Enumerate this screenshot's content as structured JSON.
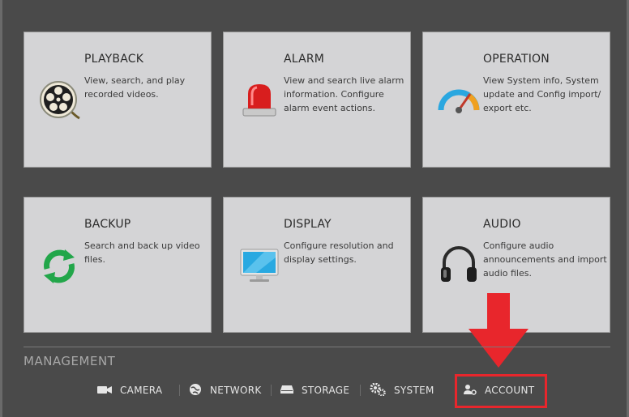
{
  "tiles": [
    {
      "id": "playback",
      "title": "PLAYBACK",
      "desc": "View, search, and play recorded videos.",
      "icon": "film-reel-icon"
    },
    {
      "id": "alarm",
      "title": "ALARM",
      "desc": "View and search live alarm information. Configure alarm event actions.",
      "icon": "siren-icon"
    },
    {
      "id": "operation",
      "title": "OPERATION",
      "desc": "View System info, System update and Config import/ export etc.",
      "icon": "gauge-icon"
    },
    {
      "id": "backup",
      "title": "BACKUP",
      "desc": "Search and back up video files.",
      "icon": "sync-arrows-icon"
    },
    {
      "id": "display",
      "title": "DISPLAY",
      "desc": "Configure resolution and display settings.",
      "icon": "monitor-icon"
    },
    {
      "id": "audio",
      "title": "AUDIO",
      "desc": "Configure audio announcements and import audio files.",
      "icon": "headphones-icon"
    }
  ],
  "management": {
    "title": "MANAGEMENT",
    "items": [
      {
        "label": "CAMERA",
        "icon": "camera-icon"
      },
      {
        "label": "NETWORK",
        "icon": "globe-icon"
      },
      {
        "label": "STORAGE",
        "icon": "hdd-icon"
      },
      {
        "label": "SYSTEM",
        "icon": "gears-icon"
      },
      {
        "label": "ACCOUNT",
        "icon": "user-gear-icon"
      }
    ]
  },
  "colors": {
    "highlight": "#e8262c",
    "tile_bg": "#d4d4d6",
    "background": "#4a4a4a"
  }
}
